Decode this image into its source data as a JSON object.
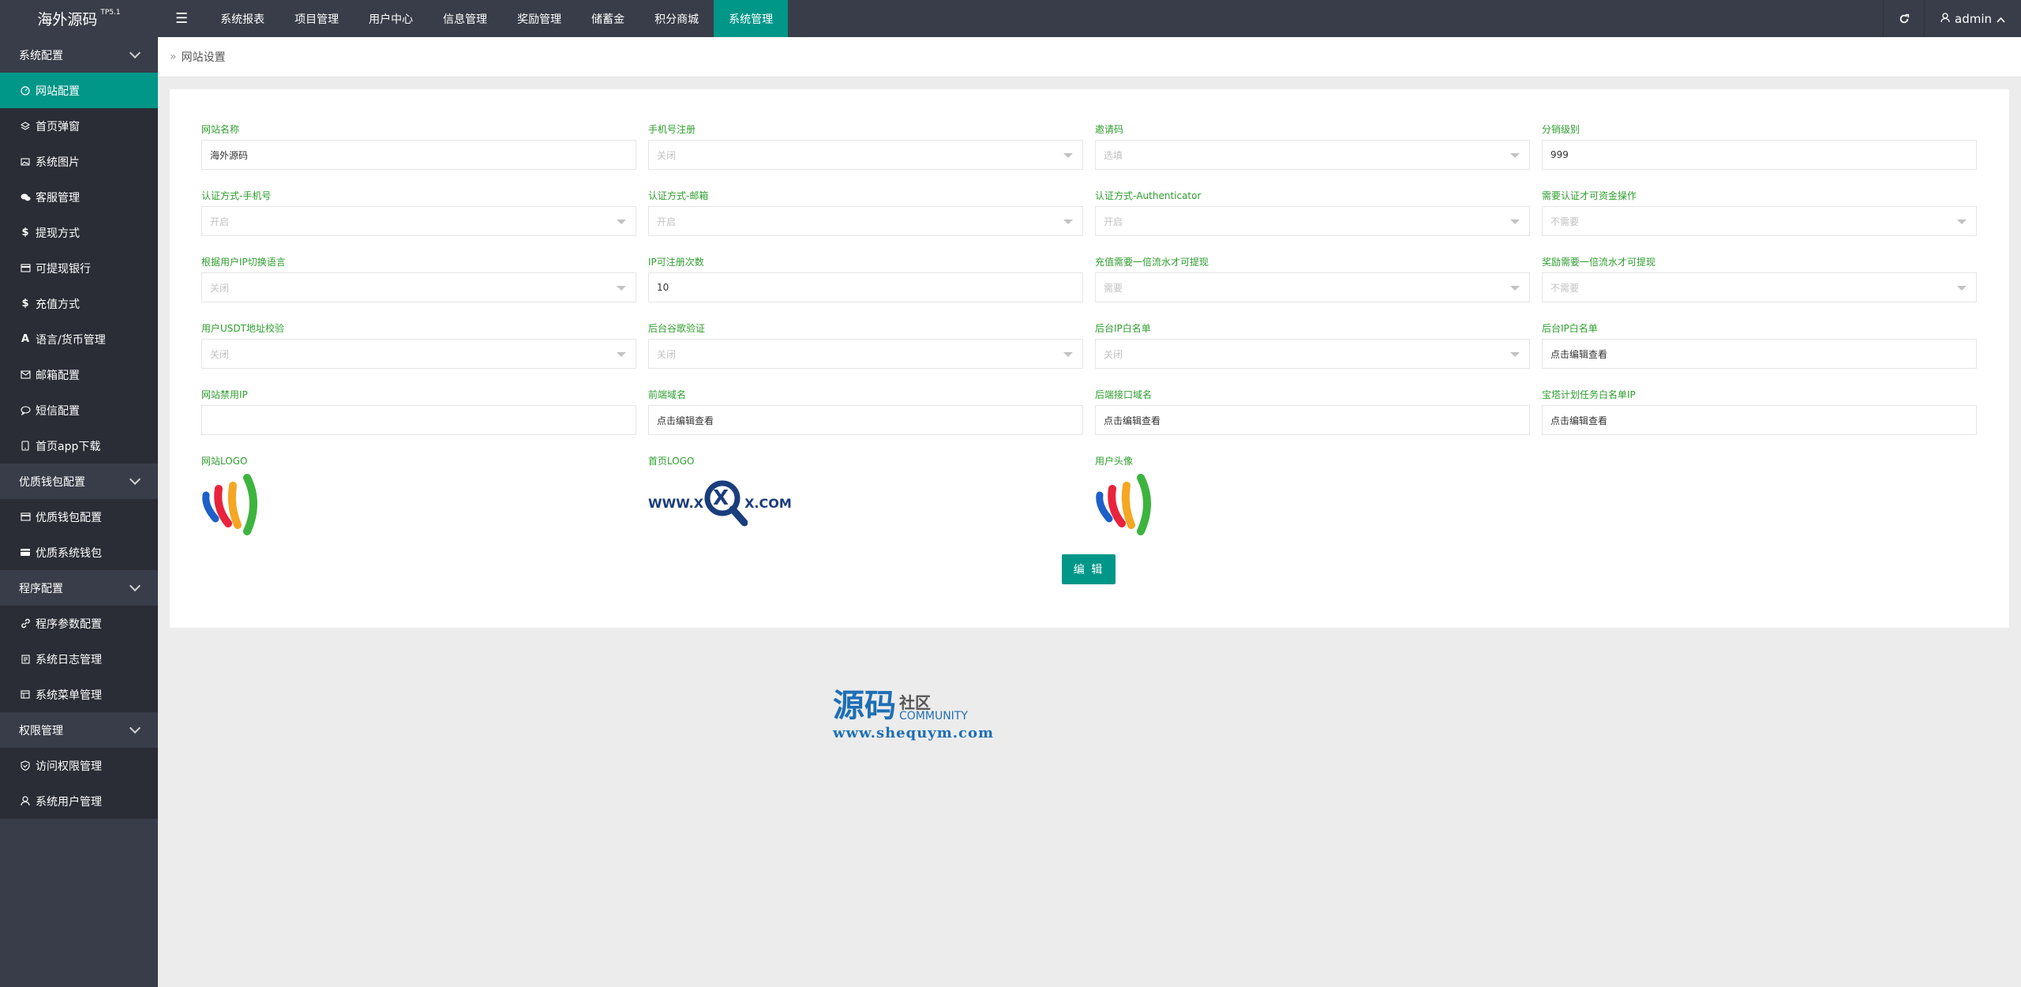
{
  "app": {
    "title": "海外源码",
    "version": "TP5.1"
  },
  "header": {
    "menu_toggle_icon": "hamburger-icon",
    "nav": [
      {
        "label": "系统报表",
        "active": false
      },
      {
        "label": "项目管理",
        "active": false
      },
      {
        "label": "用户中心",
        "active": false
      },
      {
        "label": "信息管理",
        "active": false
      },
      {
        "label": "奖励管理",
        "active": false
      },
      {
        "label": "储蓄金",
        "active": false
      },
      {
        "label": "积分商城",
        "active": false
      },
      {
        "label": "系统管理",
        "active": true
      }
    ],
    "refresh_icon": "refresh-icon",
    "user": "admin"
  },
  "sidebar": {
    "groups": [
      {
        "label": "系统配置",
        "items": [
          {
            "label": "网站配置",
            "icon": "gauge-icon",
            "active": true
          },
          {
            "label": "首页弹窗",
            "icon": "layers-icon"
          },
          {
            "label": "系统图片",
            "icon": "image-icon"
          },
          {
            "label": "客服管理",
            "icon": "chat-icon"
          },
          {
            "label": "提现方式",
            "icon": "dollar-icon"
          },
          {
            "label": "可提现银行",
            "icon": "card-icon"
          },
          {
            "label": "充值方式",
            "icon": "dollar-icon"
          },
          {
            "label": "语言/货币管理",
            "icon": "font-icon"
          },
          {
            "label": "邮箱配置",
            "icon": "mail-icon"
          },
          {
            "label": "短信配置",
            "icon": "message-icon"
          },
          {
            "label": "首页app下载",
            "icon": "mobile-icon"
          }
        ]
      },
      {
        "label": "优质钱包配置",
        "items": [
          {
            "label": "优质钱包配置",
            "icon": "card-icon"
          },
          {
            "label": "优质系统钱包",
            "icon": "wallet-icon"
          }
        ]
      },
      {
        "label": "程序配置",
        "items": [
          {
            "label": "程序参数配置",
            "icon": "link-icon"
          },
          {
            "label": "系统日志管理",
            "icon": "log-icon"
          },
          {
            "label": "系统菜单管理",
            "icon": "menu-icon"
          }
        ]
      },
      {
        "label": "权限管理",
        "items": [
          {
            "label": "访问权限管理",
            "icon": "shield-icon"
          },
          {
            "label": "系统用户管理",
            "icon": "user-icon"
          }
        ]
      }
    ]
  },
  "breadcrumb": {
    "label": "网站设置"
  },
  "form": {
    "fields": [
      {
        "label": "网站名称",
        "value": "海外源码",
        "type": "text"
      },
      {
        "label": "手机号注册",
        "value": "关闭",
        "type": "select"
      },
      {
        "label": "邀请码",
        "value": "选填",
        "type": "select"
      },
      {
        "label": "分销级别",
        "value": "999",
        "type": "text"
      },
      {
        "label": "认证方式-手机号",
        "value": "开启",
        "type": "select"
      },
      {
        "label": "认证方式-邮箱",
        "value": "开启",
        "type": "select"
      },
      {
        "label": "认证方式-Authenticator",
        "value": "开启",
        "type": "select"
      },
      {
        "label": "需要认证才可资金操作",
        "value": "不需要",
        "type": "select"
      },
      {
        "label": "根据用户IP切换语言",
        "value": "关闭",
        "type": "select"
      },
      {
        "label": "IP可注册次数",
        "value": "10",
        "type": "text"
      },
      {
        "label": "充值需要一倍流水才可提现",
        "value": "需要",
        "type": "select"
      },
      {
        "label": "奖励需要一倍流水才可提现",
        "value": "不需要",
        "type": "select"
      },
      {
        "label": "用户USDT地址校验",
        "value": "关闭",
        "type": "select"
      },
      {
        "label": "后台谷歌验证",
        "value": "关闭",
        "type": "select"
      },
      {
        "label": "后台IP白名单",
        "value": "关闭",
        "type": "select"
      },
      {
        "label": "后台IP白名单",
        "value": "点击编辑查看",
        "type": "text"
      },
      {
        "label": "网站禁用IP",
        "value": "",
        "type": "text"
      },
      {
        "label": "前端域名",
        "value": "点击编辑查看",
        "type": "text"
      },
      {
        "label": "后端接口域名",
        "value": "点击编辑查看",
        "type": "text"
      },
      {
        "label": "宝塔计划任务白名单IP",
        "value": "点击编辑查看",
        "type": "text"
      }
    ],
    "images": [
      {
        "label": "网站LOGO",
        "kind": "bars"
      },
      {
        "label": "首页LOGO",
        "kind": "wwwx",
        "text_left": "WWW.X",
        "text_x": "X",
        "text_right": "X.COM"
      },
      {
        "label": "用户头像",
        "kind": "bars"
      }
    ],
    "edit_button": "编 辑"
  },
  "watermark": {
    "big": "源码",
    "she": "社区",
    "community": "COMMUNITY",
    "url": "www.shequym.com"
  },
  "colors": {
    "header": "#393d49",
    "sidebar_sub": "#2a2d36",
    "accent": "#009688",
    "label_green": "#2e9e2e"
  }
}
